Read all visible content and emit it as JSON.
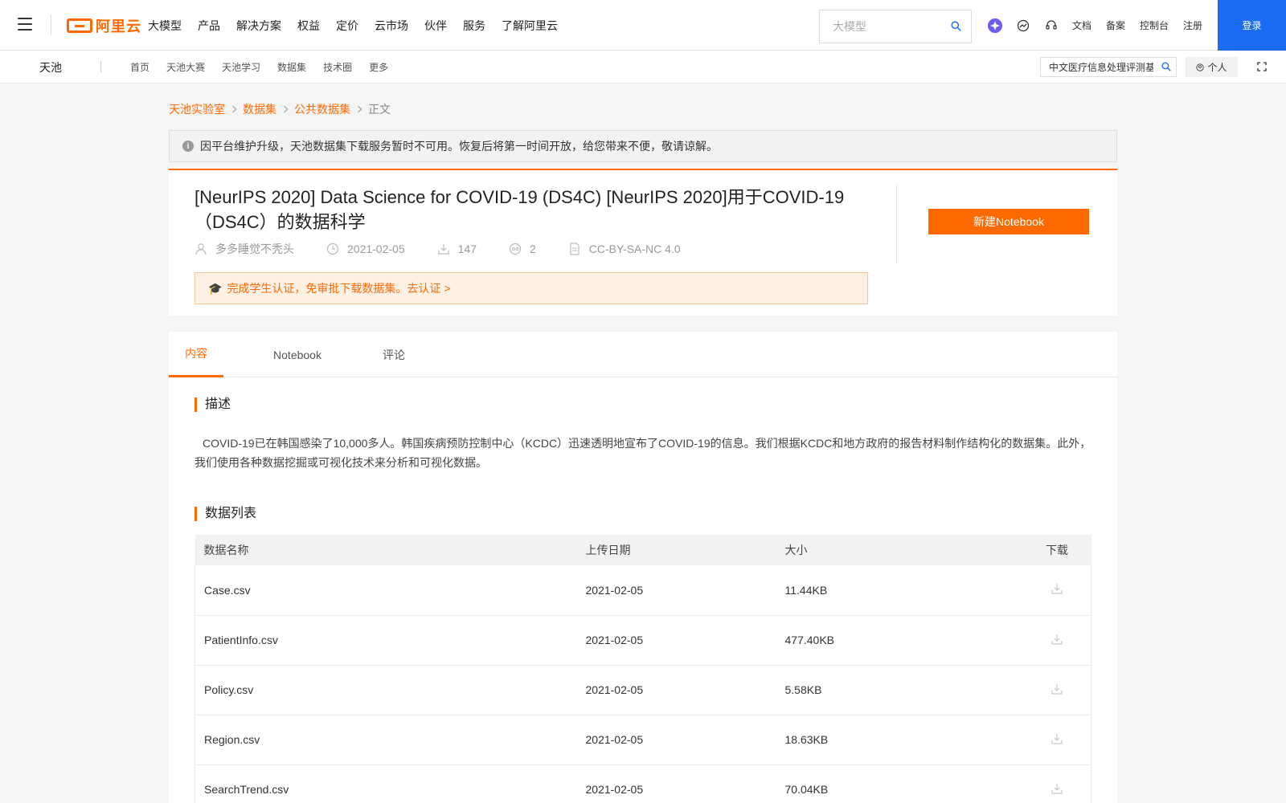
{
  "topbar": {
    "logo_text": "阿里云",
    "nav": [
      "大模型",
      "产品",
      "解决方案",
      "权益",
      "定价",
      "云市场",
      "伙伴",
      "服务",
      "了解阿里云"
    ],
    "search_placeholder": "大模型",
    "links": [
      "文档",
      "备案",
      "控制台",
      "注册"
    ],
    "login": "登录"
  },
  "subbar": {
    "brand": "天池",
    "nav": [
      "首页",
      "天池大赛",
      "天池学习",
      "数据集",
      "技术圈",
      "更多"
    ],
    "search_value": "中文医疗信息处理评测基",
    "personal": "个人"
  },
  "breadcrumb": [
    "天池实验室",
    "数据集",
    "公共数据集",
    "正文"
  ],
  "notice": "因平台维护升级，天池数据集下载服务暂时不可用。恢复后将第一时间开放，给您带来不便，敬请谅解。",
  "dataset": {
    "title": "[NeurIPS 2020] Data Science for COVID-19 (DS4C) [NeurIPS 2020]用于COVID-19（DS4C）的数据科学",
    "author": "多多睡觉不秃头",
    "date": "2021-02-05",
    "downloads": "147",
    "references": "2",
    "license": "CC-BY-SA-NC 4.0",
    "cert_banner": "完成学生认证，免审批下载数据集。去认证 >",
    "new_notebook": "新建Notebook"
  },
  "tabs": [
    "内容",
    "Notebook",
    "评论"
  ],
  "content": {
    "desc_title": "描述",
    "description": "COVID-19已在韩国感染了10,000多人。韩国疾病预防控制中心（KCDC）迅速透明地宣布了COVID-19的信息。我们根据KCDC和地方政府的报告材料制作结构化的数据集。此外，我们使用各种数据挖掘或可视化技术来分析和可视化数据。",
    "list_title": "数据列表",
    "table": {
      "headers": [
        "数据名称",
        "上传日期",
        "大小",
        "下载"
      ],
      "rows": [
        {
          "name": "Case.csv",
          "date": "2021-02-05",
          "size": "11.44KB"
        },
        {
          "name": "PatientInfo.csv",
          "date": "2021-02-05",
          "size": "477.40KB"
        },
        {
          "name": "Policy.csv",
          "date": "2021-02-05",
          "size": "5.58KB"
        },
        {
          "name": "Region.csv",
          "date": "2021-02-05",
          "size": "18.63KB"
        },
        {
          "name": "SearchTrend.csv",
          "date": "2021-02-05",
          "size": "70.04KB"
        }
      ]
    }
  },
  "colors": {
    "accent": "#ff6a00",
    "login_blue": "#1a6cf2"
  }
}
